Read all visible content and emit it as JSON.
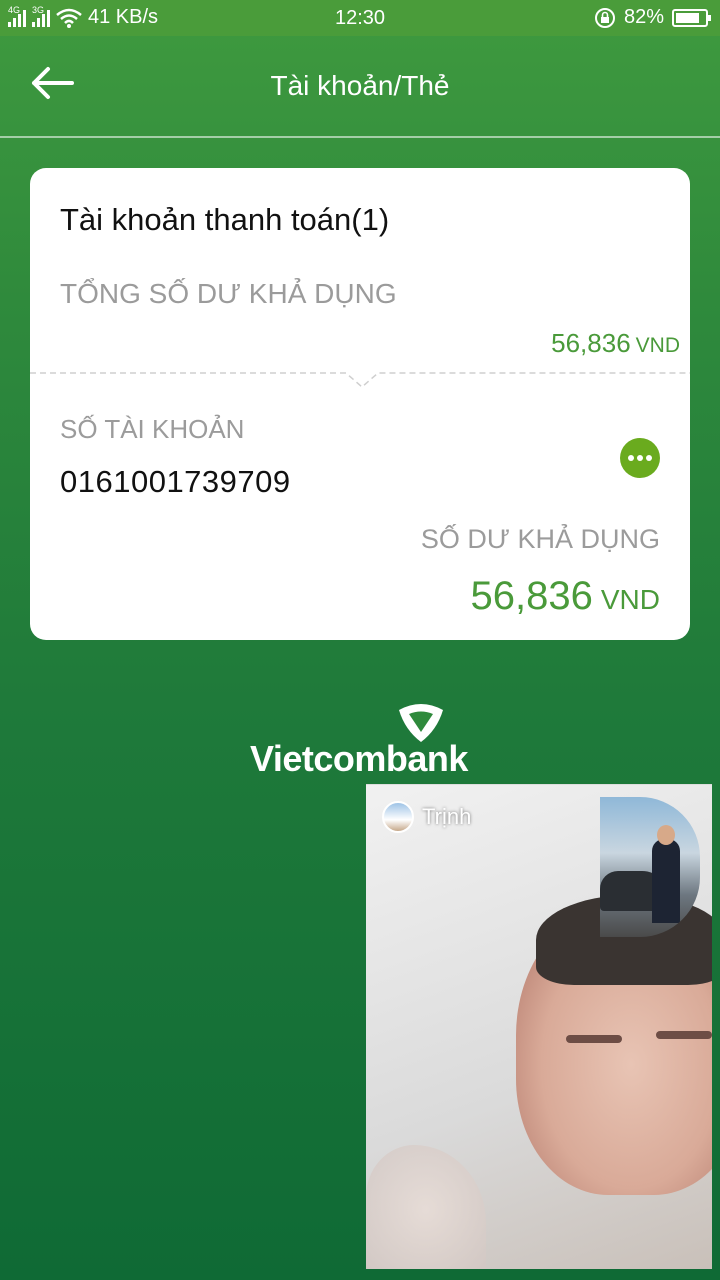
{
  "status_bar": {
    "network_1": "4G",
    "network_2": "3G",
    "speed": "41 KB/s",
    "time": "12:30",
    "battery_percent": "82%",
    "battery_level": 0.82,
    "icons": [
      "signal-icon",
      "wifi-icon",
      "rotation-lock-icon",
      "battery-icon"
    ]
  },
  "app_bar": {
    "title": "Tài khoản/Thẻ",
    "back_icon": "arrow-left-icon"
  },
  "account_card": {
    "heading": "Tài khoản thanh toán(1)",
    "total_label": "TỔNG SỐ DƯ KHẢ DỤNG",
    "total_value": "56,836",
    "total_currency": "VND",
    "account_label": "SỐ TÀI KHOẢN",
    "account_number": "0161001739709",
    "more_icon": "more-options-icon",
    "available_label": "SỐ DƯ KHẢ DỤNG",
    "available_value": "56,836",
    "available_currency": "VND"
  },
  "brand": {
    "name": "Vietcombank"
  },
  "video_call": {
    "caller_name": "Trịnh"
  },
  "colors": {
    "primary_green": "#2f8a3c",
    "status_green": "#4a9c3a",
    "amount_green": "#4a9a3a",
    "more_button": "#6aab1e",
    "label_gray": "#9b9b9b"
  }
}
